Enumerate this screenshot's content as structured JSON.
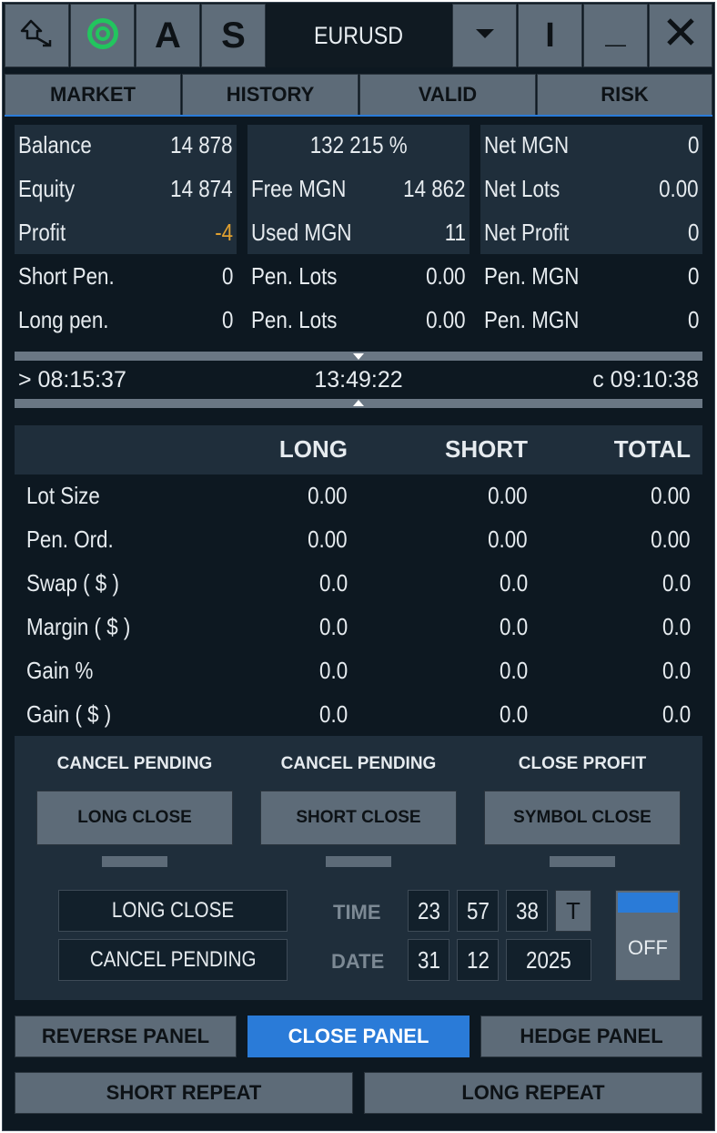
{
  "toolbar": {
    "icons": [
      "back-arrow-icon",
      "target-icon",
      "maximize-icon",
      "minimize-icon",
      "close-icon",
      "dropdown-icon"
    ],
    "a_label": "A",
    "s_label": "S",
    "symbol": "EURUSD",
    "i_label": "I",
    "min_label": "_",
    "close_label": "✕",
    "target_color": "#22c55e"
  },
  "tabs": [
    "MARKET",
    "HISTORY",
    "VALID",
    "RISK"
  ],
  "account": {
    "balance_label": "Balance",
    "balance": "14 878",
    "equity_label": "Equity",
    "equity": "14 874",
    "profit_label": "Profit",
    "profit": "-4",
    "level": "132 215 %",
    "free_mgn_label": "Free MGN",
    "free_mgn": "14 862",
    "used_mgn_label": "Used MGN",
    "used_mgn": "11",
    "net_mgn_label": "Net MGN",
    "net_mgn": "0",
    "net_lots_label": "Net Lots",
    "net_lots": "0.00",
    "net_profit_label": "Net Profit",
    "net_profit": "0",
    "short_pen_label": "Short Pen.",
    "short_pen": "0",
    "long_pen_label": "Long pen.",
    "long_pen": "0",
    "pen_lots_label_1": "Pen. Lots",
    "pen_lots_1": "0.00",
    "pen_lots_label_2": "Pen. Lots",
    "pen_lots_2": "0.00",
    "pen_mgn_label_1": "Pen. MGN",
    "pen_mgn_1": "0",
    "pen_mgn_label_2": "Pen. MGN",
    "pen_mgn_2": "0",
    "profit_color": "#e0a030"
  },
  "times": {
    "left": "> 08:15:37",
    "center": "13:49:22",
    "right": "c 09:10:38"
  },
  "table": {
    "headers": [
      "LONG",
      "SHORT",
      "TOTAL"
    ],
    "rows": [
      {
        "label": "Lot Size",
        "long": "0.00",
        "short": "0.00",
        "total": "0.00"
      },
      {
        "label": "Pen. Ord.",
        "long": "0.00",
        "short": "0.00",
        "total": "0.00"
      },
      {
        "label": "Swap ( $ )",
        "long": "0.0",
        "short": "0.0",
        "total": "0.0"
      },
      {
        "label": "Margin ( $ )",
        "long": "0.0",
        "short": "0.0",
        "total": "0.0"
      },
      {
        "label": "Gain %",
        "long": "0.0",
        "short": "0.0",
        "total": "0.0"
      },
      {
        "label": "Gain ( $ )",
        "long": "0.0",
        "short": "0.0",
        "total": "0.0"
      }
    ]
  },
  "close_panel": {
    "titles": [
      "CANCEL PENDING",
      "CANCEL PENDING",
      "CLOSE PROFIT"
    ],
    "buttons": [
      "LONG CLOSE",
      "SHORT CLOSE",
      "SYMBOL CLOSE"
    ],
    "schedule_action": "LONG CLOSE",
    "schedule_pending": "CANCEL PENDING",
    "time_label": "TIME",
    "date_label": "DATE",
    "hour": "23",
    "minute": "57",
    "second": "38",
    "t_label": "T",
    "day": "31",
    "month": "12",
    "year": "2025",
    "toggle_label": "OFF",
    "toggle_color": "#2a7bd8"
  },
  "footer": {
    "reverse": "REVERSE PANEL",
    "close": "CLOSE PANEL",
    "hedge": "HEDGE PANEL",
    "short_repeat": "SHORT REPEAT",
    "long_repeat": "LONG REPEAT",
    "active_color": "#2a7bd8"
  }
}
